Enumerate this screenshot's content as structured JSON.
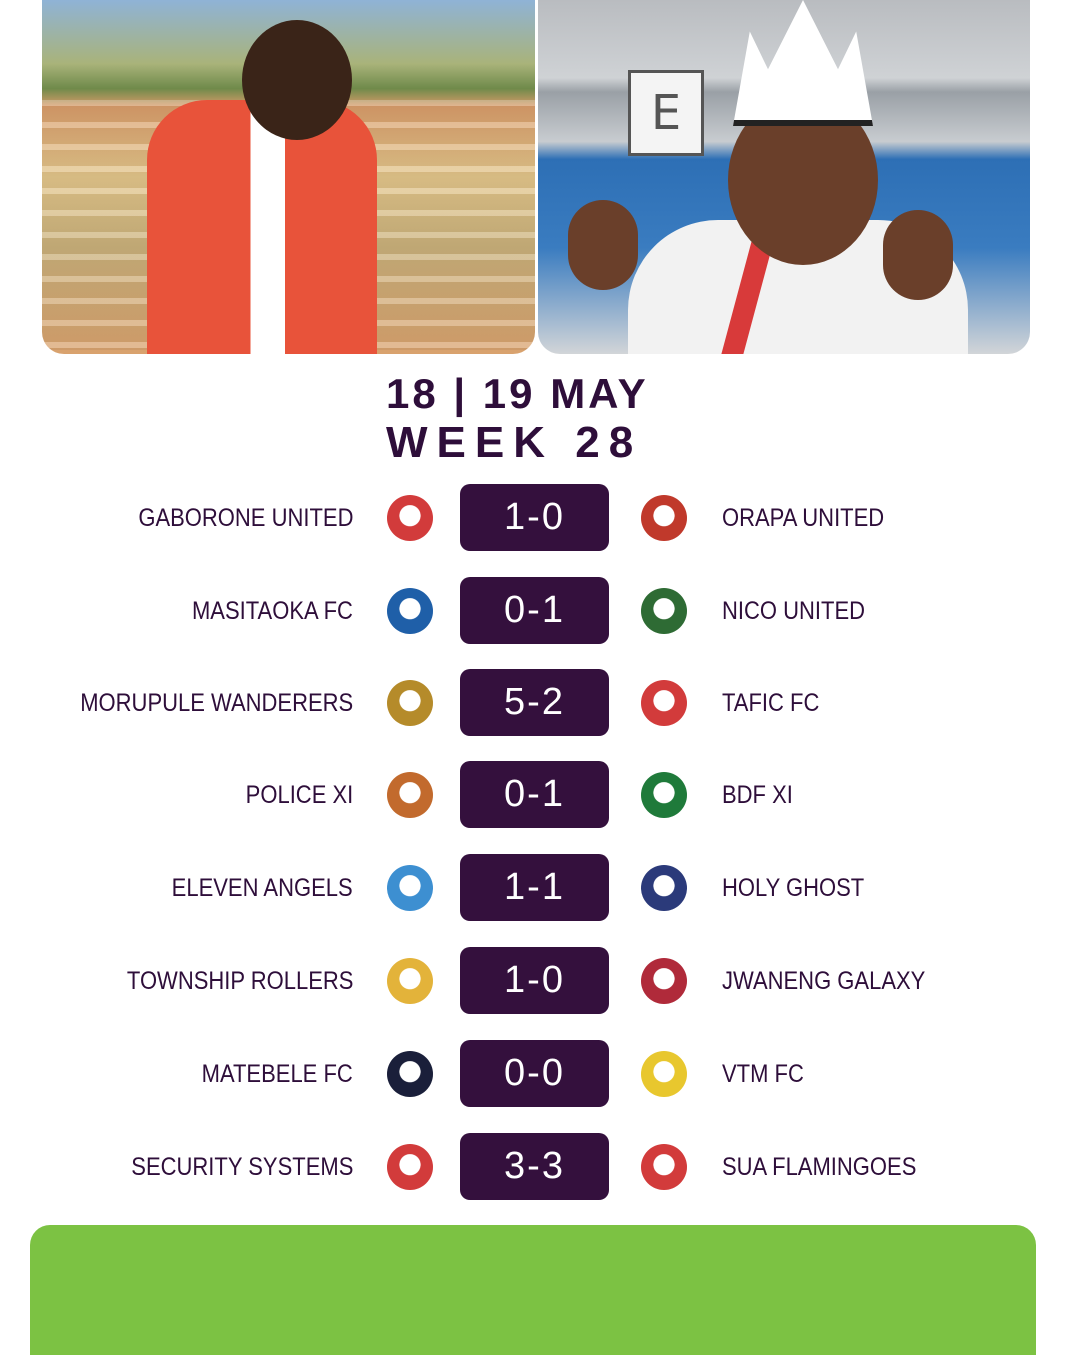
{
  "header": {
    "dates": "18 | 19  MAY",
    "week": "WEEK  28"
  },
  "colors": {
    "score_bg": "#34103d",
    "text": "#2e0e3a",
    "footer": "#7cc243"
  },
  "matches": [
    {
      "home": "GABORONE UNITED",
      "score": "1-0",
      "away": "ORAPA UNITED",
      "home_color": "#d23b3b",
      "away_color": "#c0392b"
    },
    {
      "home": "MASITAOKA FC",
      "score": "0-1",
      "away": "NICO UNITED",
      "home_color": "#1f5fa8",
      "away_color": "#2e6b34"
    },
    {
      "home": "MORUPULE WANDERERS",
      "score": "5-2",
      "away": "TAFIC FC",
      "home_color": "#b58b2a",
      "away_color": "#d23b3b"
    },
    {
      "home": "POLICE XI",
      "score": "0-1",
      "away": "BDF XI",
      "home_color": "#c26a2d",
      "away_color": "#1f7a3a"
    },
    {
      "home": "ELEVEN ANGELS",
      "score": "1-1",
      "away": "HOLY GHOST",
      "home_color": "#3d8fd1",
      "away_color": "#2b3a7a"
    },
    {
      "home": "TOWNSHIP ROLLERS",
      "score": "1-0",
      "away": "JWANENG GALAXY",
      "home_color": "#e3b33a",
      "away_color": "#b02a3a"
    },
    {
      "home": "MATEBELE FC",
      "score": "0-0",
      "away": "VTM FC",
      "home_color": "#1a1f3a",
      "away_color": "#e8c72e"
    },
    {
      "home": "SECURITY SYSTEMS",
      "score": "3-3",
      "away": "SUA FLAMINGOES",
      "home_color": "#d23b3b",
      "away_color": "#d23b3b"
    }
  ]
}
